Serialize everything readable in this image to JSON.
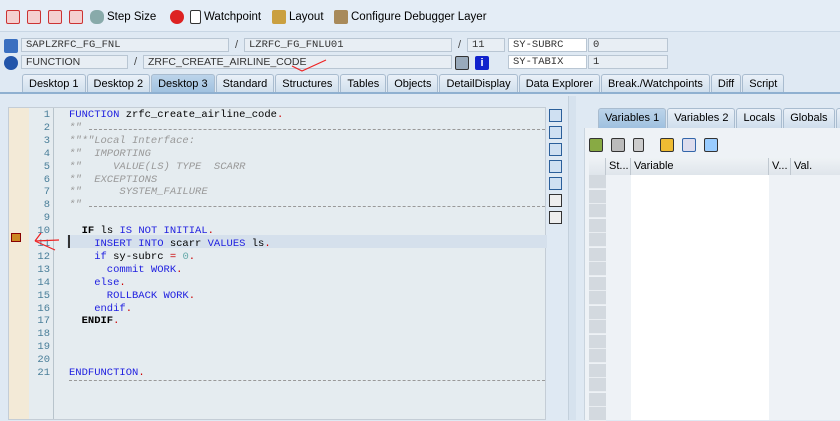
{
  "toolbar": {
    "step_size": "Step Size",
    "watchpoint": "Watchpoint",
    "layout": "Layout",
    "configure": "Configure Debugger Layer"
  },
  "fields": {
    "program": "SAPLZRFC_FG_FNL",
    "include": "LZRFC_FG_FNLU01",
    "line": "11",
    "type": "FUNCTION",
    "name": "ZRFC_CREATE_AIRLINE_CODE",
    "sys1_name": "SY-SUBRC",
    "sys1_val": "0",
    "sys2_name": "SY-TABIX",
    "sys2_val": "1",
    "sep": "/"
  },
  "tabs": [
    "Desktop 1",
    "Desktop 2",
    "Desktop 3",
    "Standard",
    "Structures",
    "Tables",
    "Objects",
    "DetailDisplay",
    "Data Explorer",
    "Break./Watchpoints",
    "Diff",
    "Script"
  ],
  "var_tabs": [
    "Variables 1",
    "Variables 2",
    "Locals",
    "Globals",
    "A"
  ],
  "var_columns": [
    "St...",
    "Variable",
    "V...",
    "Val."
  ],
  "code": [
    [
      [
        "kw",
        "FUNCTION"
      ],
      [
        "tx",
        " zrfc_create_airline_code"
      ],
      [
        "pn",
        "."
      ]
    ],
    [
      [
        "cm",
        "*\""
      ]
    ],
    [
      [
        "cm",
        "*\"*\"Local Interface:"
      ]
    ],
    [
      [
        "cm",
        "*\"  IMPORTING"
      ]
    ],
    [
      [
        "cm",
        "*\"     VALUE(LS) TYPE  SCARR"
      ]
    ],
    [
      [
        "cm",
        "*\"  EXCEPTIONS"
      ]
    ],
    [
      [
        "cm",
        "*\"      SYSTEM_FAILURE"
      ]
    ],
    [
      [
        "cm",
        "*\""
      ]
    ],
    [],
    [
      [
        "kb",
        "  IF"
      ],
      [
        "tx",
        " ls "
      ],
      [
        "kw",
        "IS NOT INITIAL"
      ],
      [
        "pn",
        "."
      ]
    ],
    [
      [
        "kw",
        "    INSERT INTO"
      ],
      [
        "tx",
        " scarr "
      ],
      [
        "kw",
        "VALUES"
      ],
      [
        "tx",
        " ls"
      ],
      [
        "pn",
        "."
      ]
    ],
    [
      [
        "kw",
        "    if"
      ],
      [
        "tx",
        " sy-subrc "
      ],
      [
        "pn",
        "="
      ],
      [
        "nm",
        " 0"
      ],
      [
        "pn",
        "."
      ]
    ],
    [
      [
        "kw",
        "      commit WORK"
      ],
      [
        "pn",
        "."
      ]
    ],
    [
      [
        "kw",
        "    else"
      ],
      [
        "pn",
        "."
      ]
    ],
    [
      [
        "kw",
        "      ROLLBACK WORK"
      ],
      [
        "pn",
        "."
      ]
    ],
    [
      [
        "kw",
        "    endif"
      ],
      [
        "pn",
        "."
      ]
    ],
    [
      [
        "kb",
        "  ENDIF"
      ],
      [
        "pn",
        "."
      ]
    ],
    [],
    [],
    [],
    [
      [
        "kw",
        "ENDFUNCTION"
      ],
      [
        "pn",
        "."
      ]
    ]
  ]
}
